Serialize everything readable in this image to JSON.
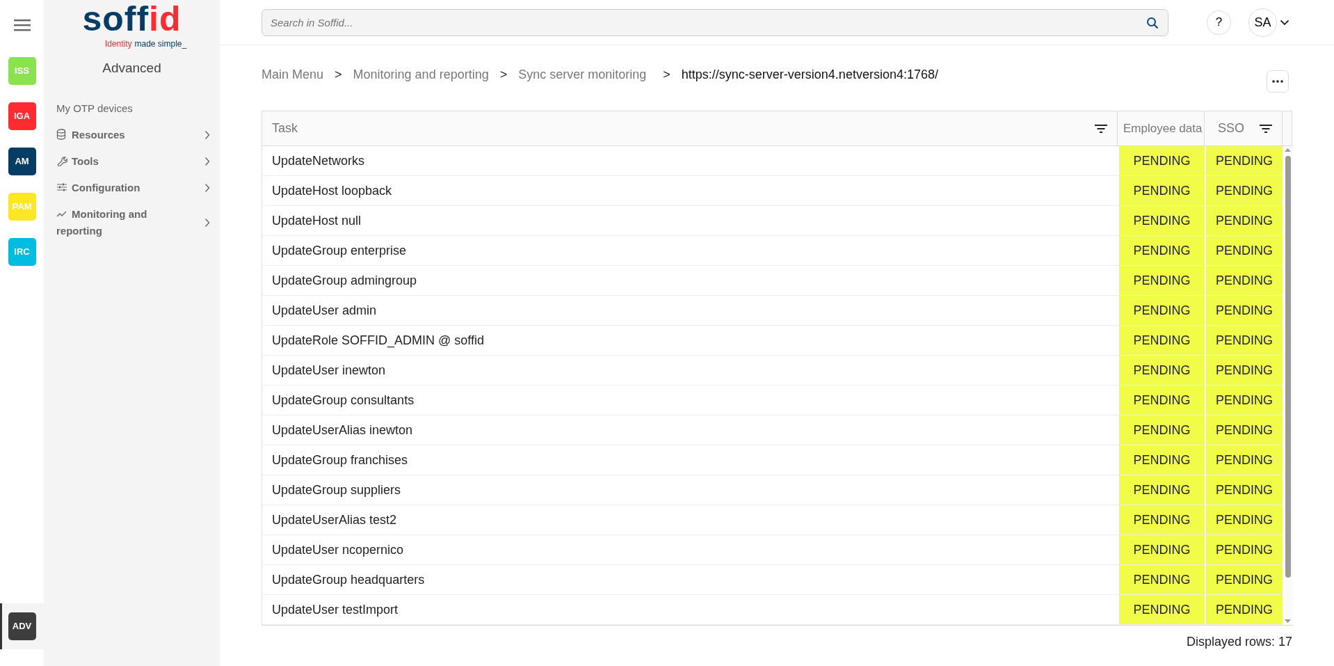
{
  "app_rail": [
    {
      "label": "ISS",
      "color": "#8ae24e",
      "selected": false
    },
    {
      "label": "IGA",
      "color": "#ff2b30",
      "selected": false
    },
    {
      "label": "AM",
      "color": "#053d64",
      "selected": false
    },
    {
      "label": "PAM",
      "color": "#fde725",
      "selected": false
    },
    {
      "label": "IRC",
      "color": "#02bde0",
      "selected": false
    },
    {
      "label": "ADV",
      "color": "#3d3d3d",
      "selected": true
    }
  ],
  "sidebar": {
    "logo": {
      "name": "soff",
      "name_accent": "id",
      "tagline_accent": "Identity",
      "tagline": "made simple_"
    },
    "title": "Advanced",
    "items": [
      {
        "label": "My OTP devices",
        "kind": "plain"
      },
      {
        "label": "Resources",
        "kind": "database"
      },
      {
        "label": "Tools",
        "kind": "wrench"
      },
      {
        "label": "Configuration",
        "kind": "sliders"
      },
      {
        "label": "Monitoring and reporting",
        "kind": "chart"
      }
    ]
  },
  "header": {
    "search": {
      "placeholder": "Search in Soffid..."
    },
    "help": "?",
    "user": "SA"
  },
  "breadcrumb": [
    "Main Menu",
    "Monitoring and reporting",
    "Sync server monitoring",
    "https://sync-server-version4.netversion4:1768/"
  ],
  "breadcrumb_separator": ">",
  "table": {
    "columns": [
      {
        "label": "Task",
        "filter": true
      },
      {
        "label": "Employee data",
        "filter": false
      },
      {
        "label": "SSO",
        "filter": true
      }
    ],
    "rows": [
      {
        "cells": [
          {
            "text": "UpdateNetworks"
          },
          {
            "text": "PENDING",
            "color": "#f0fc48"
          },
          {
            "text": "PENDING",
            "color": "#f0fc48"
          }
        ]
      },
      {
        "cells": [
          {
            "text": "UpdateHost loopback"
          },
          {
            "text": "PENDING",
            "color": "#f0fc48"
          },
          {
            "text": "PENDING",
            "color": "#f0fc48"
          }
        ]
      },
      {
        "cells": [
          {
            "text": "UpdateHost null"
          },
          {
            "text": "PENDING",
            "color": "#f0fc48"
          },
          {
            "text": "PENDING",
            "color": "#f0fc48"
          }
        ]
      },
      {
        "cells": [
          {
            "text": "UpdateGroup enterprise"
          },
          {
            "text": "PENDING",
            "color": "#f0fc48"
          },
          {
            "text": "PENDING",
            "color": "#f0fc48"
          }
        ]
      },
      {
        "cells": [
          {
            "text": "UpdateGroup admingroup"
          },
          {
            "text": "PENDING",
            "color": "#f0fc48"
          },
          {
            "text": "PENDING",
            "color": "#f0fc48"
          }
        ]
      },
      {
        "cells": [
          {
            "text": "UpdateUser admin"
          },
          {
            "text": "PENDING",
            "color": "#f0fc48"
          },
          {
            "text": "PENDING",
            "color": "#f0fc48"
          }
        ]
      },
      {
        "cells": [
          {
            "text": "UpdateRole SOFFID_ADMIN @ soffid"
          },
          {
            "text": "PENDING",
            "color": "#f0fc48"
          },
          {
            "text": "PENDING",
            "color": "#f0fc48"
          }
        ]
      },
      {
        "cells": [
          {
            "text": "UpdateUser inewton"
          },
          {
            "text": "PENDING",
            "color": "#f0fc48"
          },
          {
            "text": "PENDING",
            "color": "#f0fc48"
          }
        ]
      },
      {
        "cells": [
          {
            "text": "UpdateGroup consultants"
          },
          {
            "text": "PENDING",
            "color": "#f0fc48"
          },
          {
            "text": "PENDING",
            "color": "#f0fc48"
          }
        ]
      },
      {
        "cells": [
          {
            "text": "UpdateUserAlias inewton"
          },
          {
            "text": "PENDING",
            "color": "#f0fc48"
          },
          {
            "text": "PENDING",
            "color": "#f0fc48"
          }
        ]
      },
      {
        "cells": [
          {
            "text": "UpdateGroup franchises"
          },
          {
            "text": "PENDING",
            "color": "#f0fc48"
          },
          {
            "text": "PENDING",
            "color": "#f0fc48"
          }
        ]
      },
      {
        "cells": [
          {
            "text": "UpdateGroup suppliers"
          },
          {
            "text": "PENDING",
            "color": "#f0fc48"
          },
          {
            "text": "PENDING",
            "color": "#f0fc48"
          }
        ]
      },
      {
        "cells": [
          {
            "text": "UpdateUserAlias test2"
          },
          {
            "text": "PENDING",
            "color": "#f0fc48"
          },
          {
            "text": "PENDING",
            "color": "#f0fc48"
          }
        ]
      },
      {
        "cells": [
          {
            "text": "UpdateUser ncopernico"
          },
          {
            "text": "PENDING",
            "color": "#f0fc48"
          },
          {
            "text": "PENDING",
            "color": "#f0fc48"
          }
        ]
      },
      {
        "cells": [
          {
            "text": "UpdateGroup headquarters"
          },
          {
            "text": "PENDING",
            "color": "#f0fc48"
          },
          {
            "text": "PENDING",
            "color": "#f0fc48"
          }
        ]
      },
      {
        "cells": [
          {
            "text": "UpdateUser testImport"
          },
          {
            "text": "PENDING",
            "color": "#f0fc48"
          },
          {
            "text": "PENDING",
            "color": "#f0fc48"
          }
        ]
      }
    ],
    "footer": "Displayed rows: 17"
  }
}
